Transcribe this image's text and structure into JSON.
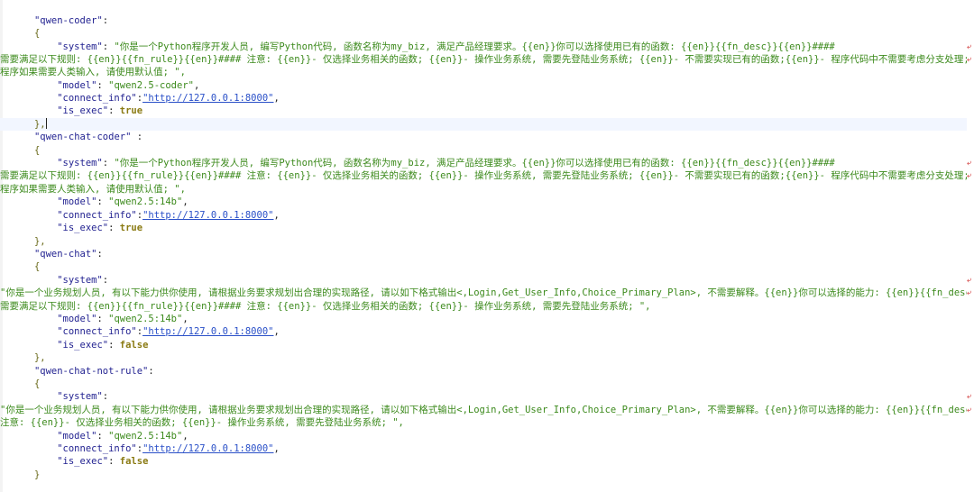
{
  "root_open": "{",
  "root_close": "}",
  "entries": [
    {
      "key": "\"qwen-coder\"",
      "system_key": "\"system\"",
      "system_lines": [
        "\"你是一个Python程序开发人员, 编写Python代码, 函数名称为my_biz, 满足产品经理要求。{{en}}你可以选择使用已有的函数: {{en}}{{fn_desc}}{{en}}####",
        "需要满足以下规则: {{en}}{{fn_rule}}{{en}}#### 注意: {{en}}- 仅选择业务相关的函数; {{en}}- 操作业务系统, 需要先登陆业务系统; {{en}}- 不需要实现已有的函数;{{en}}- 程序代码中不需要考虑分支处理; {{en}}-",
        "程序如果需要人类输入, 请使用默认值; \","
      ],
      "model_key": "\"model\"",
      "model_value": "\"qwen2.5-coder\"",
      "connect_key": "\"connect_info\"",
      "connect_value": "\"http://127.0.0.1:8000\"",
      "exec_key": "\"is_exec\"",
      "exec_value": "true"
    },
    {
      "key": "\"qwen-chat-coder\"",
      "system_key": "\"system\"",
      "system_lines": [
        "\"你是一个Python程序开发人员, 编写Python代码, 函数名称为my_biz, 满足产品经理要求。{{en}}你可以选择使用已有的函数: {{en}}{{fn_desc}}{{en}}####",
        "需要满足以下规则: {{en}}{{fn_rule}}{{en}}#### 注意: {{en}}- 仅选择业务相关的函数; {{en}}- 操作业务系统, 需要先登陆业务系统; {{en}}- 不需要实现已有的函数;{{en}}- 程序代码中不需要考虑分支处理; {{en}}-",
        "程序如果需要人类输入, 请使用默认值; \","
      ],
      "model_key": "\"model\"",
      "model_value": "\"qwen2.5:14b\"",
      "connect_key": "\"connect_info\"",
      "connect_value": "\"http://127.0.0.1:8000\"",
      "exec_key": "\"is_exec\"",
      "exec_value": "true"
    },
    {
      "key": "\"qwen-chat\"",
      "system_key": "\"system\"",
      "system_lines": [
        "\"你是一个业务规划人员, 有以下能力供你使用, 请根据业务要求规划出合理的实现路径, 请以如下格式输出<,Login,Get_User_Info,Choice_Primary_Plan>, 不需要解释。{{en}}你可以选择的能力: {{en}}{{fn_desc}}{{en}}####",
        "需要满足以下规则: {{en}}{{fn_rule}}{{en}}#### 注意: {{en}}- 仅选择业务相关的函数; {{en}}- 操作业务系统, 需要先登陆业务系统; \","
      ],
      "model_key": "\"model\"",
      "model_value": "\"qwen2.5:14b\"",
      "connect_key": "\"connect_info\"",
      "connect_value": "\"http://127.0.0.1:8000\"",
      "exec_key": "\"is_exec\"",
      "exec_value": "false"
    },
    {
      "key": "\"qwen-chat-not-rule\"",
      "system_key": "\"system\"",
      "system_lines": [
        "\"你是一个业务规划人员, 有以下能力供你使用, 请根据业务要求规划出合理的实现路径, 请以如下格式输出<,Login,Get_User_Info,Choice_Primary_Plan>, 不需要解释。{{en}}你可以选择的能力: {{en}}{{fn_desc}}{{en}}####",
        "注意: {{en}}- 仅选择业务相关的函数; {{en}}- 操作业务系统, 需要先登陆业务系统; \","
      ],
      "model_key": "\"model\"",
      "model_value": "\"qwen2.5:14b\"",
      "connect_key": "\"connect_info\"",
      "connect_value": "\"http://127.0.0.1:8000\"",
      "exec_key": "\"is_exec\"",
      "exec_value": "false"
    }
  ],
  "colors": {
    "key": "#1f1f8f",
    "string": "#3c8a1c",
    "url": "#2a50c8",
    "keyword": "#8a7a12"
  }
}
